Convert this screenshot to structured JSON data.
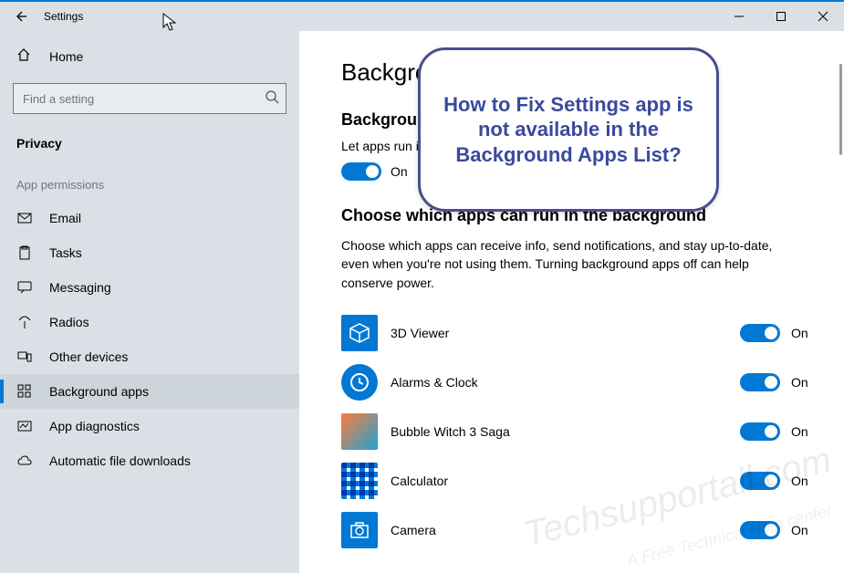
{
  "window": {
    "title": "Settings"
  },
  "sidebar": {
    "home_label": "Home",
    "search_placeholder": "Find a setting",
    "category": "Privacy",
    "section_label": "App permissions",
    "items": [
      {
        "label": "Email",
        "icon": "mail-icon"
      },
      {
        "label": "Tasks",
        "icon": "clipboard-icon"
      },
      {
        "label": "Messaging",
        "icon": "message-icon"
      },
      {
        "label": "Radios",
        "icon": "antenna-icon"
      },
      {
        "label": "Other devices",
        "icon": "devices-icon"
      },
      {
        "label": "Background apps",
        "icon": "grid-icon",
        "selected": true
      },
      {
        "label": "App diagnostics",
        "icon": "diagnostics-icon"
      },
      {
        "label": "Automatic file downloads",
        "icon": "cloud-icon"
      }
    ]
  },
  "main": {
    "title": "Background apps",
    "section1_heading": "Background Apps",
    "master_label": "Let apps run in the background",
    "master_state": "On",
    "section2_heading": "Choose which apps can run in the background",
    "section2_desc": "Choose which apps can receive info, send notifications, and stay up-to-date, even when you're not using them. Turning background apps off can help conserve power.",
    "apps": [
      {
        "name": "3D Viewer",
        "state": "On"
      },
      {
        "name": "Alarms & Clock",
        "state": "On"
      },
      {
        "name": "Bubble Witch 3 Saga",
        "state": "On"
      },
      {
        "name": "Calculator",
        "state": "On"
      },
      {
        "name": "Camera",
        "state": "On"
      }
    ]
  },
  "callout": {
    "text": "How to Fix Settings app is not available in the Background Apps List?"
  },
  "watermark": {
    "line1": "Techsupportall.com",
    "line2": "A Free Technical Help center"
  }
}
